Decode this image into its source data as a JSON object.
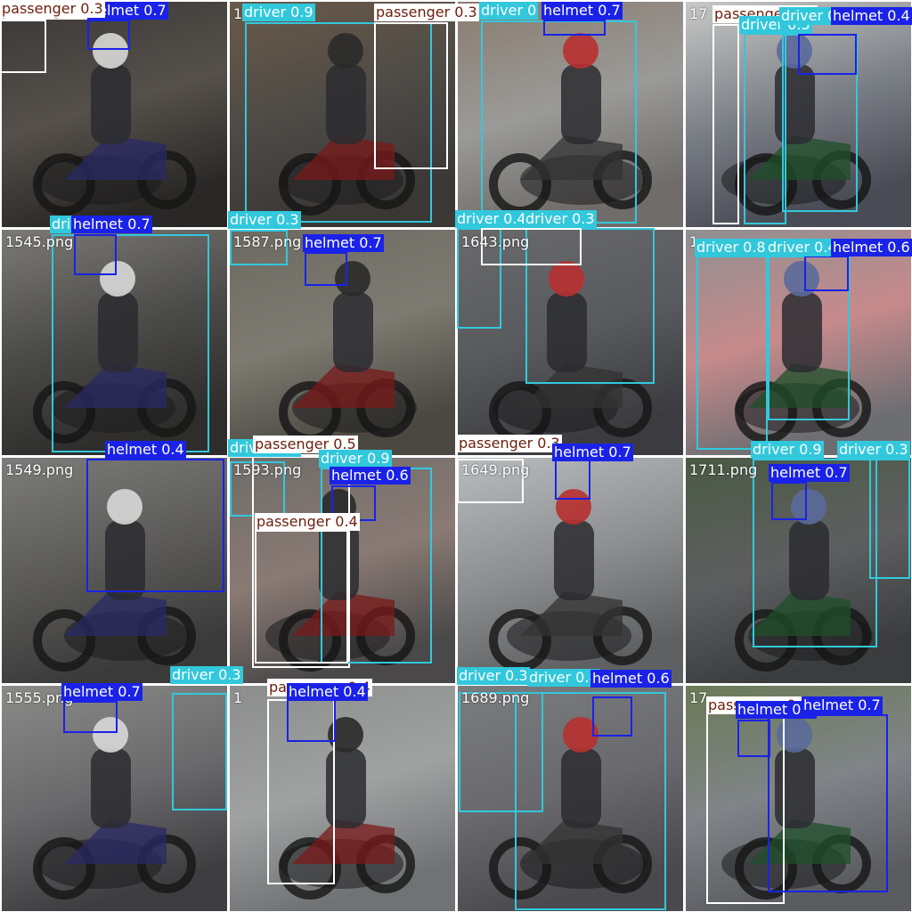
{
  "colors": {
    "driver": "#32c8dc",
    "helmet": "#1a22e8",
    "passenger": "#ffffff",
    "driver_text": "#ffffff",
    "helmet_text": "#ffffff",
    "passenger_text": "#6b1e0c"
  },
  "tiles": [
    {
      "name": "",
      "bg": [
        "#3a3836",
        "#55504b",
        "#2a2826"
      ]
    },
    {
      "name": "1",
      "bg": [
        "#6a5a4a",
        "#4d4a46",
        "#3a3735"
      ]
    },
    {
      "name": "",
      "bg": [
        "#8a7c70",
        "#9a9a98",
        "#6f6c69"
      ]
    },
    {
      "name": "17",
      "bg": [
        "#c8c8c6",
        "#7b7f86",
        "#4a4c55"
      ]
    },
    {
      "name": "1545.png",
      "bg": [
        "#7c7a76",
        "#4a4a48",
        "#2e2d2c"
      ]
    },
    {
      "name": "1587.png",
      "bg": [
        "#6d6a62",
        "#7d7a72",
        "#4a4840"
      ]
    },
    {
      "name": "1643.png",
      "bg": [
        "#6a6a6c",
        "#585a5e",
        "#3c3c40"
      ]
    },
    {
      "name": "1",
      "bg": [
        "#8e8f91",
        "#c78a8c",
        "#6d6e72"
      ]
    },
    {
      "name": "1549.png",
      "bg": [
        "#7c7c7a",
        "#5b5a58",
        "#3a3a3a"
      ]
    },
    {
      "name": "1593.png",
      "bg": [
        "#6e6c68",
        "#8a7a74",
        "#4a4848"
      ]
    },
    {
      "name": "1649.png",
      "bg": [
        "#b9bcbf",
        "#8c8e90",
        "#5f6062"
      ]
    },
    {
      "name": "1711.png",
      "bg": [
        "#4a5a44",
        "#5e5f60",
        "#3a3c3e"
      ]
    },
    {
      "name": "1555.png",
      "bg": [
        "#8a8a88",
        "#6a6a6c",
        "#3e3e40"
      ]
    },
    {
      "name": "1",
      "bg": [
        "#8c8e8e",
        "#a0a2a2",
        "#707274"
      ]
    },
    {
      "name": "1689.png",
      "bg": [
        "#7a7c7e",
        "#6a6a6e",
        "#4a4a4e"
      ]
    },
    {
      "name": "17",
      "bg": [
        "#6a7a56",
        "#808488",
        "#5a5c60"
      ]
    }
  ],
  "detections": [
    {
      "cls": "passenger",
      "label": "passenger 0.3"
    },
    {
      "cls": "helmet",
      "label": "helmet 0.7"
    },
    {
      "cls": "driver",
      "label": "driver 0.9"
    },
    {
      "cls": "passenger",
      "label": "passenger 0.3"
    },
    {
      "cls": "driver",
      "label": "driver 0"
    },
    {
      "cls": "helmet",
      "label": "helmet 0.7"
    },
    {
      "cls": "passenger",
      "label": "passenger 0.3"
    },
    {
      "cls": "driver",
      "label": "driver 0.3"
    },
    {
      "cls": "driver",
      "label": "driver 0.3"
    },
    {
      "cls": "helmet",
      "label": "helmet 0.4"
    },
    {
      "cls": "driver",
      "label": "driver 0.3"
    },
    {
      "cls": "helmet",
      "label": "helmet 0.7"
    },
    {
      "cls": "driver",
      "label": "driver 0.3"
    },
    {
      "cls": "helmet",
      "label": "helmet 0.7"
    },
    {
      "cls": "driver",
      "label": "driver 0.4"
    },
    {
      "cls": "driver",
      "label": "driver 0.3"
    },
    {
      "cls": "passenger",
      "label": "passenger 0.3"
    },
    {
      "cls": "driver",
      "label": "driver 0.8"
    },
    {
      "cls": "driver",
      "label": "driver 0.4"
    },
    {
      "cls": "helmet",
      "label": "helmet 0.6"
    },
    {
      "cls": "helmet",
      "label": "helmet 0.4"
    },
    {
      "cls": "driver",
      "label": "driver 0.3"
    },
    {
      "cls": "passenger",
      "label": "passenger 0.5"
    },
    {
      "cls": "driver",
      "label": "driver 0.9"
    },
    {
      "cls": "helmet",
      "label": "helmet 0.6"
    },
    {
      "cls": "passenger",
      "label": "passenger 0.4"
    },
    {
      "cls": "passenger",
      "label": "passenger 0.3"
    },
    {
      "cls": "helmet",
      "label": "helmet 0.7"
    },
    {
      "cls": "driver",
      "label": "driver 0.9"
    },
    {
      "cls": "driver",
      "label": "driver 0.3"
    },
    {
      "cls": "helmet",
      "label": "helmet 0.7"
    },
    {
      "cls": "helmet",
      "label": "helmet 0.7"
    },
    {
      "cls": "driver",
      "label": "driver 0.3"
    },
    {
      "cls": "passenger",
      "label": "passenger 0.4"
    },
    {
      "cls": "helmet",
      "label": "helmet 0.4"
    },
    {
      "cls": "driver",
      "label": "driver 0.3"
    },
    {
      "cls": "driver",
      "label": "driver 0.8"
    },
    {
      "cls": "helmet",
      "label": "helmet 0.6"
    },
    {
      "cls": "passenger",
      "label": "passenger 0.3"
    },
    {
      "cls": "helmet",
      "label": "helmet 0.6"
    },
    {
      "cls": "helmet",
      "label": "helmet 0.7"
    }
  ]
}
